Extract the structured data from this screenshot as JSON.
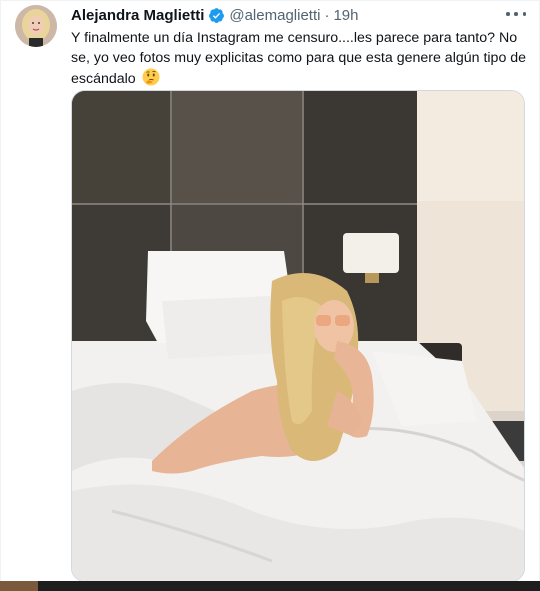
{
  "tweet": {
    "author": {
      "display_name": "Alejandra Maglietti",
      "handle": "@alemaglietti",
      "verified": true,
      "avatar_icon": "profile-avatar"
    },
    "separator": "·",
    "time": "19h",
    "text": "Y finalmente un día Instagram me censuro....les parece para tanto? No se, yo veo fotos muy explicitas como para que esta genere algún tipo de escándalo",
    "emoji": "thinking-face-emoji",
    "more_icon": "more-options-icon",
    "media": {
      "type": "photo",
      "icon": "tweet-photo"
    }
  },
  "colors": {
    "text_primary": "#0f1419",
    "text_secondary": "#536471",
    "verified_blue": "#1d9bf0",
    "border": "#cfd9de"
  }
}
